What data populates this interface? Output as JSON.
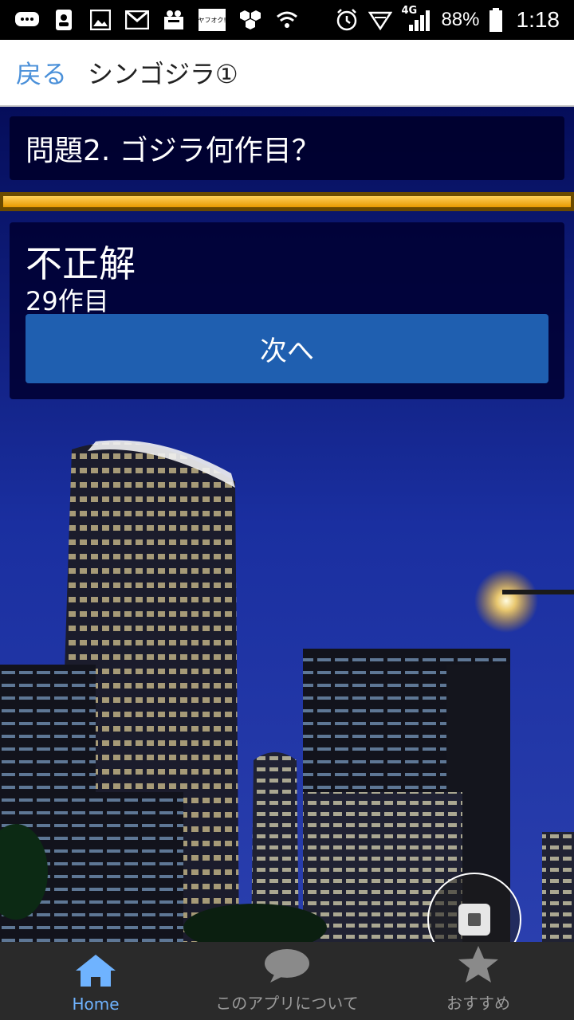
{
  "status_bar": {
    "left_icons": [
      "messages-icon",
      "contacts-icon",
      "gallery-icon",
      "gmail-icon",
      "package-icon",
      "yahoo-auction-icon",
      "hexagon-app-icon",
      "wifi-icon"
    ],
    "yahoo_label": "ヤフオク!",
    "network": "4G",
    "battery": "88%",
    "time": "1:18"
  },
  "appbar": {
    "back_label": "戻る",
    "title": "シンゴジラ①"
  },
  "question": {
    "text": "問題2. ゴジラ何作目？"
  },
  "progress": {
    "fraction": 1.0
  },
  "result": {
    "title": "不正解",
    "answer": "29作目",
    "next_label": "次へ"
  },
  "bottom_nav": {
    "items": [
      {
        "label": "Home",
        "icon": "home-icon",
        "active": true
      },
      {
        "label": "このアプリについて",
        "icon": "chat-bubble-icon",
        "active": false
      },
      {
        "label": "おすすめ",
        "icon": "star-icon",
        "active": false
      }
    ]
  },
  "colors": {
    "accent": "#4a90d9",
    "button": "#1f5fb0",
    "progress": "#f0a800",
    "nav_active": "#6fb3ff"
  }
}
